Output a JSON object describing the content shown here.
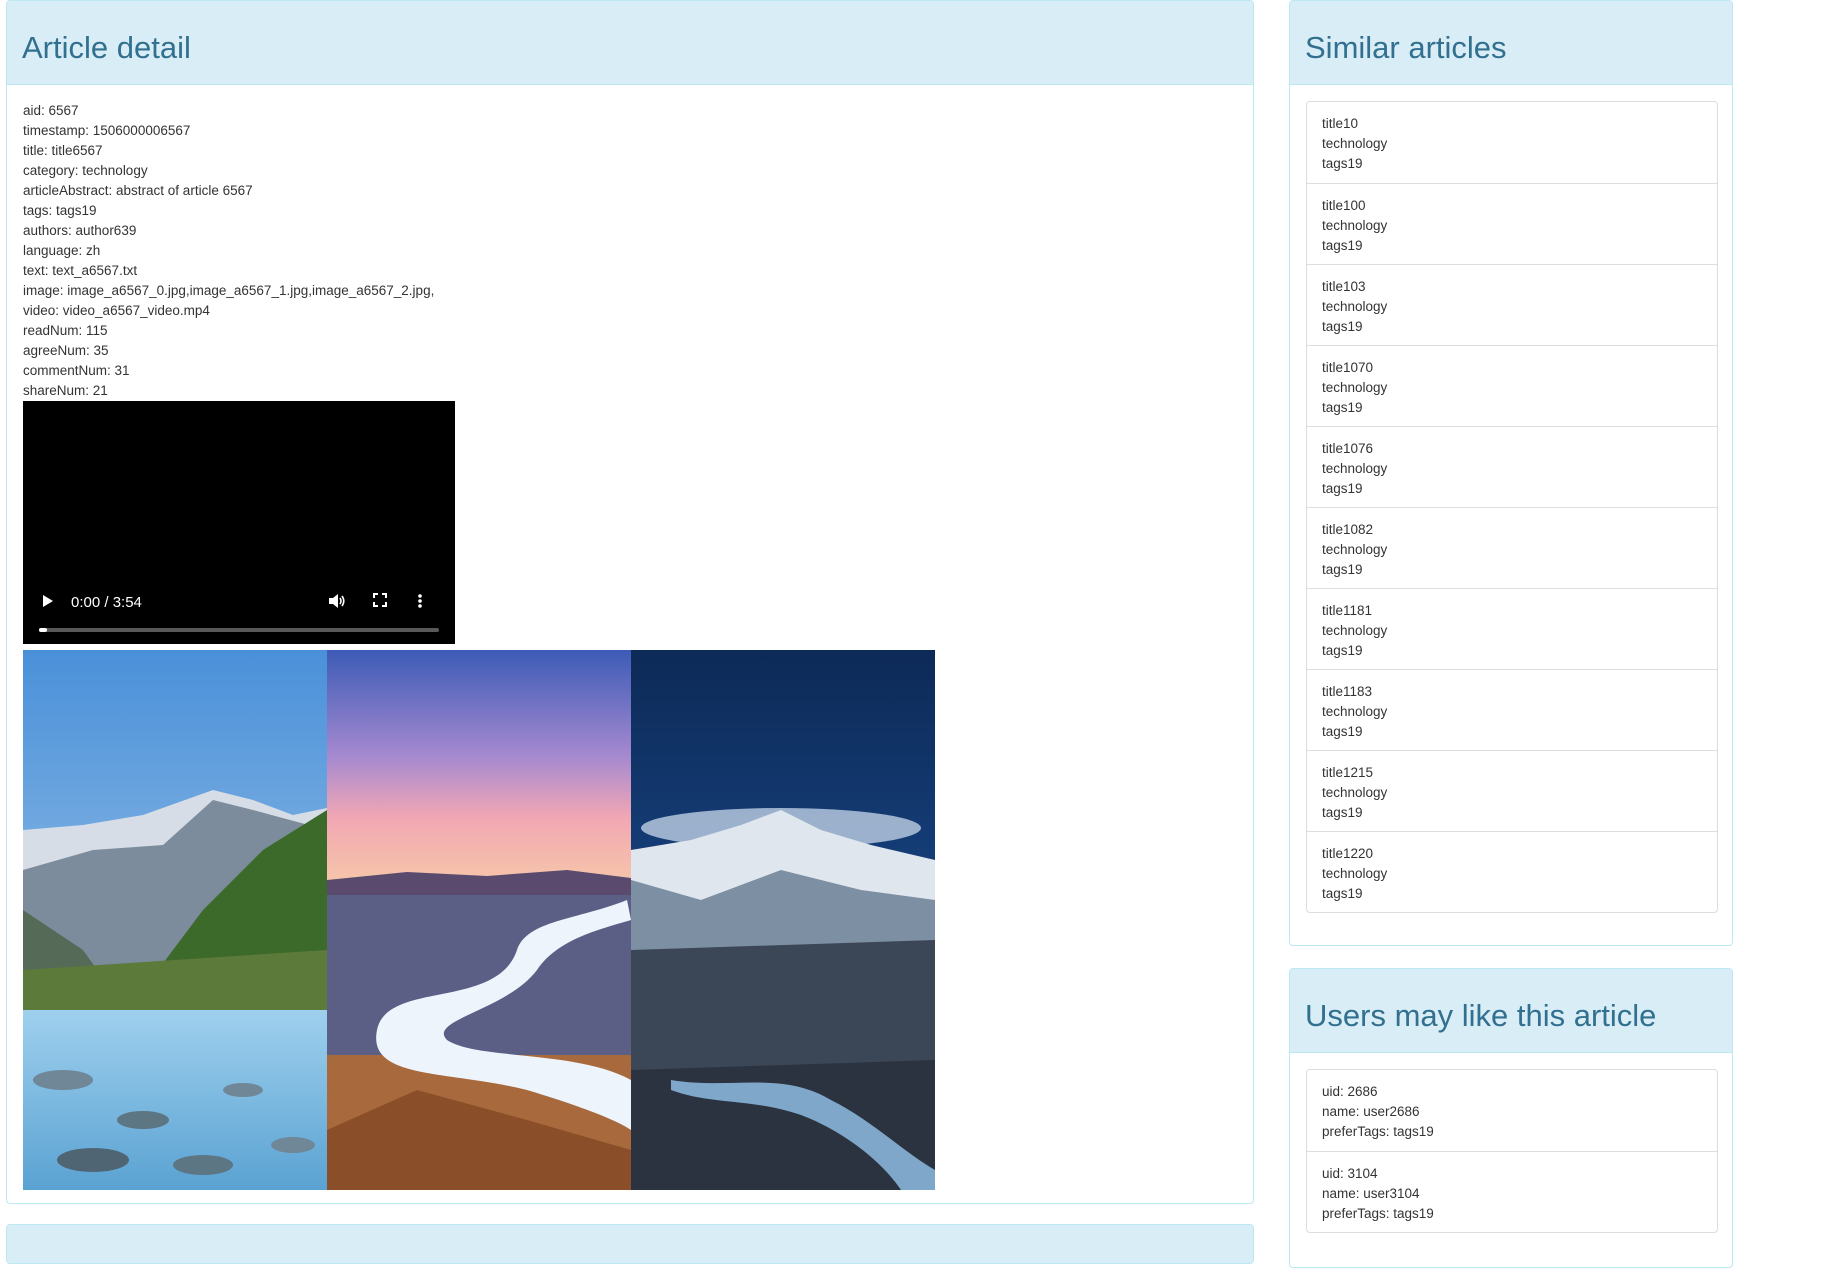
{
  "article_panel": {
    "title": "Article detail",
    "fields": [
      "aid: 6567",
      "timestamp: 1506000006567",
      "title: title6567",
      "category: technology",
      "articleAbstract: abstract of article 6567",
      "tags: tags19",
      "authors: author639",
      "language: zh",
      "text: text_a6567.txt",
      "image: image_a6567_0.jpg,image_a6567_1.jpg,image_a6567_2.jpg,",
      "video: video_a6567_video.mp4",
      "readNum: 115",
      "agreeNum: 35",
      "commentNum: 31",
      "shareNum: 21"
    ],
    "video": {
      "time": "0:00 / 3:54",
      "progress": 0.02,
      "icons": [
        "play-icon",
        "volume-icon",
        "fullscreen-icon",
        "more-options-icon"
      ]
    },
    "images": [
      "mountain-river-landscape",
      "snowy-river-sunset-landscape",
      "night-snow-mountain-landscape"
    ]
  },
  "similar_panel": {
    "title": "Similar articles",
    "items": [
      {
        "title": "title10",
        "category": "technology",
        "tags": "tags19"
      },
      {
        "title": "title100",
        "category": "technology",
        "tags": "tags19"
      },
      {
        "title": "title103",
        "category": "technology",
        "tags": "tags19"
      },
      {
        "title": "title1070",
        "category": "technology",
        "tags": "tags19"
      },
      {
        "title": "title1076",
        "category": "technology",
        "tags": "tags19"
      },
      {
        "title": "title1082",
        "category": "technology",
        "tags": "tags19"
      },
      {
        "title": "title1181",
        "category": "technology",
        "tags": "tags19"
      },
      {
        "title": "title1183",
        "category": "technology",
        "tags": "tags19"
      },
      {
        "title": "title1215",
        "category": "technology",
        "tags": "tags19"
      },
      {
        "title": "title1220",
        "category": "technology",
        "tags": "tags19"
      }
    ]
  },
  "users_panel": {
    "title": "Users may like this article",
    "items": [
      {
        "uid": "uid: 2686",
        "name": "name: user2686",
        "tags": "preferTags: tags19"
      },
      {
        "uid": "uid: 3104",
        "name": "name: user3104",
        "tags": "preferTags: tags19"
      }
    ]
  },
  "colors": {
    "heading_bg": "#d9edf7",
    "heading_border": "#bce8f1",
    "heading_text": "#31708f"
  }
}
